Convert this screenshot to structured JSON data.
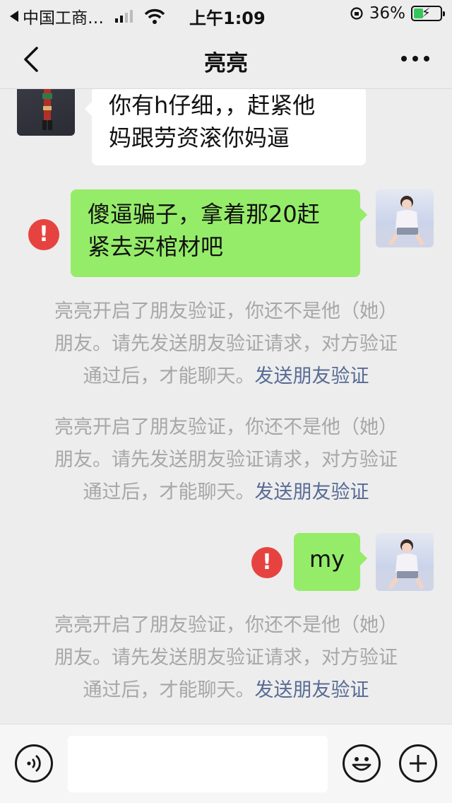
{
  "status_bar": {
    "carrier": "中国工商…",
    "time": "上午1:09",
    "battery_percent": "36%",
    "battery_level": 0.36
  },
  "nav": {
    "title": "亮亮",
    "back_icon": "chevron-left-icon",
    "more_icon": "more-dots-icon"
  },
  "messages": [
    {
      "direction": "in",
      "text_lines": [
        "你有h仔细，，赶紧他",
        "妈跟劳资滚你妈逼"
      ]
    },
    {
      "direction": "out",
      "failed": true,
      "text_lines": [
        "傻逼骗子，拿着那20赶",
        "紧去买棺材吧"
      ]
    },
    {
      "type": "system",
      "lines": [
        "亮亮开启了朋友验证，你还不是他（她）",
        "朋友。请先发送朋友验证请求，对方验证",
        "通过后，才能聊天。"
      ],
      "link": "发送朋友验证"
    },
    {
      "type": "system",
      "lines": [
        "亮亮开启了朋友验证，你还不是他（她）",
        "朋友。请先发送朋友验证请求，对方验证",
        "通过后，才能聊天。"
      ],
      "link": "发送朋友验证"
    },
    {
      "direction": "out",
      "failed": true,
      "text_lines": [
        "my"
      ]
    },
    {
      "type": "system",
      "lines": [
        "亮亮开启了朋友验证，你还不是他（她）",
        "朋友。请先发送朋友验证请求，对方验证",
        "通过后，才能聊天。"
      ],
      "link": "发送朋友验证"
    }
  ],
  "alert_symbol": "!",
  "input_bar": {
    "input_value": "",
    "voice_icon": "voice-icon",
    "emoji_icon": "emoji-icon",
    "plus_icon": "plus-icon"
  },
  "colors": {
    "background": "#ededed",
    "bubble_out": "#95ec69",
    "bubble_in": "#ffffff",
    "alert": "#e64340",
    "link": "#576b95",
    "system_text": "#a7a7a7"
  }
}
